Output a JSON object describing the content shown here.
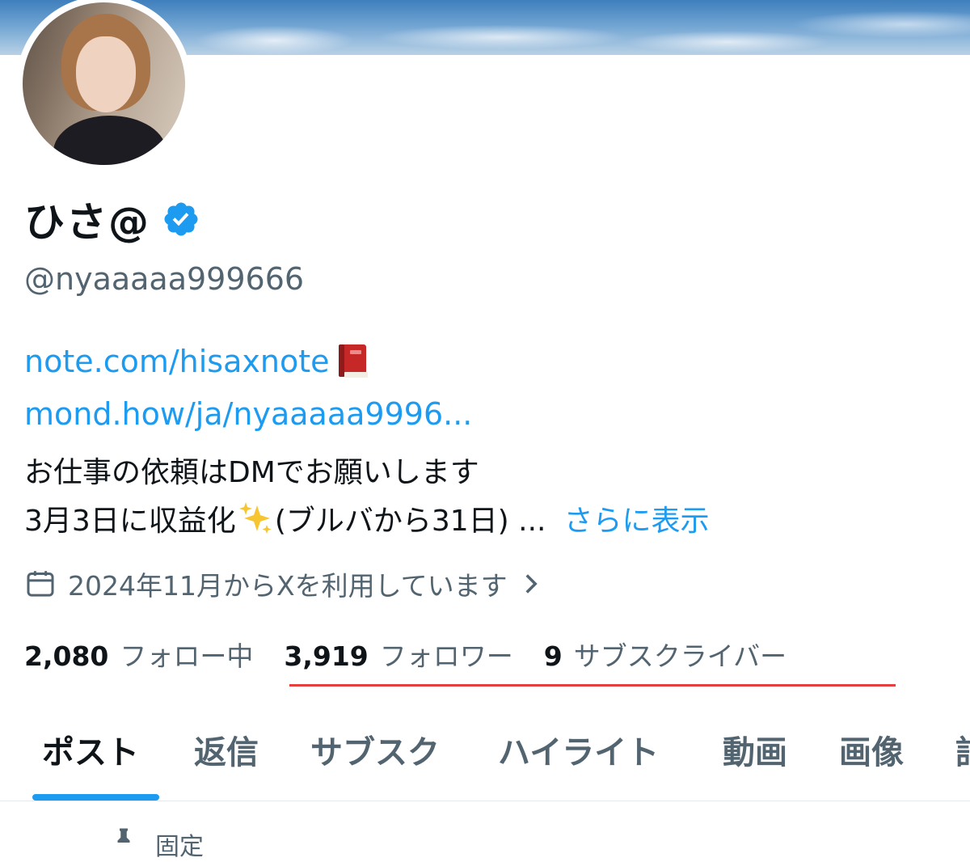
{
  "profile": {
    "display_name": "ひさ@",
    "handle": "@nyaaaaa999666",
    "links": [
      "note.com/hisaxnote",
      "mond.how/ja/nyaaaaa9996..."
    ],
    "bio_line1": "お仕事の依頼はDMでお願いします",
    "bio_line2_prefix": "3月3日に収益化",
    "bio_line2_suffix": "(ブルバから31日) ...",
    "more_label": "さらに表示",
    "joined_text": "2024年11月からXを利用しています"
  },
  "stats": {
    "following_count": "2,080",
    "following_label": "フォロー中",
    "followers_count": "3,919",
    "followers_label": "フォロワー",
    "subscribers_count": "9",
    "subscribers_label": "サブスクライバー"
  },
  "tabs": [
    {
      "label": "ポスト",
      "active": true
    },
    {
      "label": "返信",
      "active": false
    },
    {
      "label": "サブスク",
      "active": false
    },
    {
      "label": "ハイライト",
      "active": false
    },
    {
      "label": "動画",
      "active": false
    },
    {
      "label": "画像",
      "active": false
    },
    {
      "label": "記",
      "active": false
    }
  ],
  "peek": {
    "label": "固定"
  },
  "icons": {
    "verified": "verified-badge-icon",
    "book": "red-book-emoji",
    "sparkle": "sparkles-emoji",
    "calendar": "calendar-icon",
    "chevron": "chevron-right-icon",
    "pin": "pin-icon"
  },
  "colors": {
    "accent": "#1d9bf0",
    "text": "#0f1419",
    "secondary": "#536471",
    "annotation_underline": "#e53f3f"
  }
}
